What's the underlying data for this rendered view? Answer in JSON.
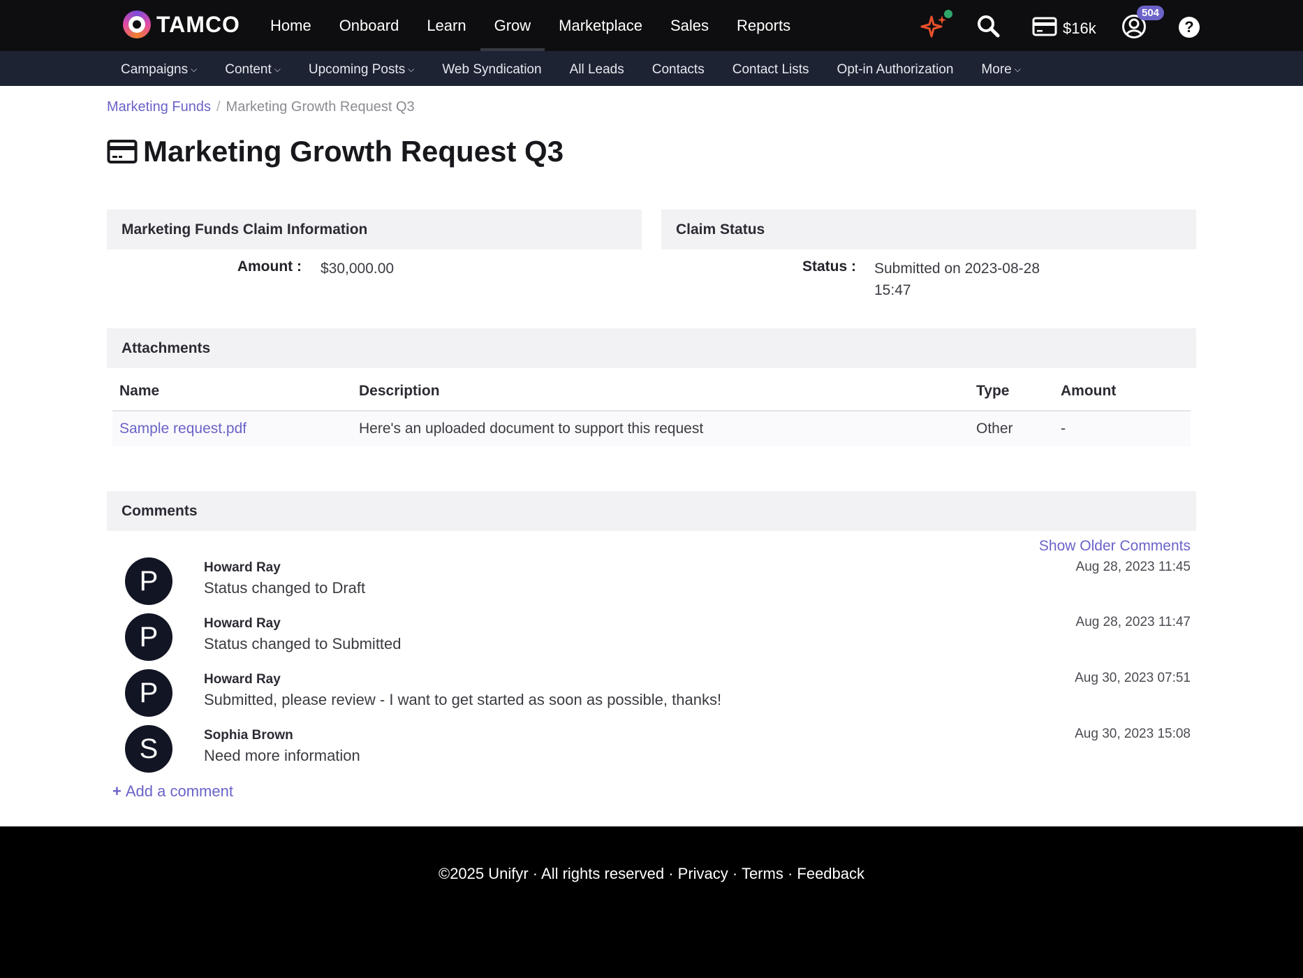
{
  "app": {
    "brand": "TAMCO",
    "funds": "$16k",
    "notification_count": "504",
    "help_glyph": "?"
  },
  "main_nav": [
    {
      "label": "Home",
      "active": false
    },
    {
      "label": "Onboard",
      "active": false
    },
    {
      "label": "Learn",
      "active": false
    },
    {
      "label": "Grow",
      "active": true
    },
    {
      "label": "Marketplace",
      "active": false
    },
    {
      "label": "Sales",
      "active": false
    },
    {
      "label": "Reports",
      "active": false
    }
  ],
  "sub_nav": [
    {
      "label": "Campaigns",
      "dropdown": true
    },
    {
      "label": "Content",
      "dropdown": true
    },
    {
      "label": "Upcoming Posts",
      "dropdown": true
    },
    {
      "label": "Web Syndication",
      "dropdown": false
    },
    {
      "label": "All Leads",
      "dropdown": false
    },
    {
      "label": "Contacts",
      "dropdown": false
    },
    {
      "label": "Contact Lists",
      "dropdown": false
    },
    {
      "label": "Opt-in Authorization",
      "dropdown": false
    },
    {
      "label": "More",
      "dropdown": true
    }
  ],
  "breadcrumb": {
    "parent": "Marketing Funds",
    "separator": "/",
    "current": "Marketing Growth Request Q3"
  },
  "page": {
    "title": "Marketing Growth Request Q3",
    "title_icon": "credit-card-icon"
  },
  "claim_info": {
    "heading": "Marketing Funds Claim Information",
    "amount_label": "Amount :",
    "amount_value": "$30,000.00"
  },
  "claim_status": {
    "heading": "Claim Status",
    "status_label": "Status :",
    "status_line1": "Submitted on 2023-08-28",
    "status_line2": "15:47"
  },
  "attachments": {
    "heading": "Attachments",
    "columns": [
      "Name",
      "Description",
      "Type",
      "Amount"
    ],
    "rows": [
      {
        "name": "Sample request.pdf",
        "description": "Here's an uploaded document to support this request",
        "type": "Other",
        "amount": "-"
      }
    ]
  },
  "comments": {
    "heading": "Comments",
    "show_older": "Show Older Comments",
    "add_label": "Add a comment",
    "items": [
      {
        "initial": "P",
        "author": "Howard Ray",
        "text": "Status changed to Draft",
        "time": "Aug 28, 2023 11:45"
      },
      {
        "initial": "P",
        "author": "Howard Ray",
        "text": "Status changed to Submitted",
        "time": "Aug 28, 2023 11:47"
      },
      {
        "initial": "P",
        "author": "Howard Ray",
        "text": "Submitted, please review - I want to get started as soon as possible, thanks!",
        "time": "Aug 30, 2023 07:51"
      },
      {
        "initial": "S",
        "author": "Sophia Brown",
        "text": "Need more information",
        "time": "Aug 30, 2023 15:08"
      }
    ]
  },
  "footer": {
    "copyright": "©2025  Unifyr · All rights reserved · ",
    "privacy": "Privacy",
    "dot": " · ",
    "terms": "Terms",
    "feedback": "Feedback"
  },
  "colors": {
    "accent": "#6a63c8",
    "topbar": "#0e0e10",
    "subnav": "#1d2333",
    "panel_header": "#f2f2f5",
    "avatar": "#121523"
  }
}
